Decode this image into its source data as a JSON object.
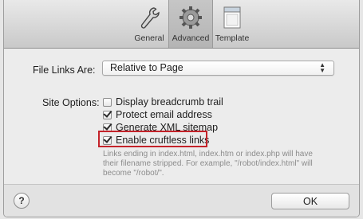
{
  "toolbar": {
    "tabs": [
      {
        "label": "General",
        "icon": "wrench-icon"
      },
      {
        "label": "Advanced",
        "icon": "gear-icon",
        "selected": true
      },
      {
        "label": "Template",
        "icon": "page-icon"
      }
    ]
  },
  "file_links": {
    "label": "File Links Are:",
    "value": "Relative to Page",
    "arrows": "▲▼"
  },
  "site_options": {
    "label": "Site Options:",
    "options": [
      {
        "label": "Display breadcrumb trail",
        "checked": false
      },
      {
        "label": "Protect email address",
        "checked": true
      },
      {
        "label": "Generate XML sitemap",
        "checked": true
      },
      {
        "label": "Enable cruftless links",
        "checked": true
      }
    ],
    "help_text": "Links ending in index.html, index.htm or index.php will have their filename stripped. For example, \"/robot/index.html\" will become \"/robot/\"."
  },
  "footer": {
    "help_label": "?",
    "ok_label": "OK"
  },
  "colors": {
    "highlight": "#c4232a",
    "help_text": "#8c8c8c"
  }
}
